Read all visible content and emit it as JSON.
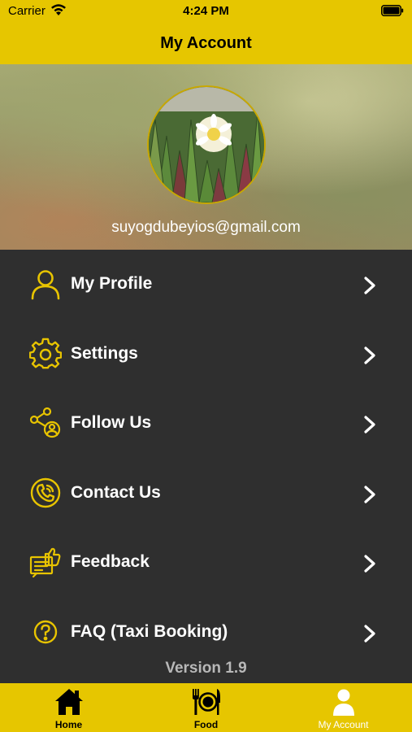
{
  "status_bar": {
    "carrier": "Carrier",
    "time": "4:24 PM"
  },
  "nav": {
    "title": "My Account"
  },
  "profile": {
    "email": "suyogdubeyios@gmail.com"
  },
  "menu": {
    "items": [
      {
        "label": "My Profile",
        "icon": "person-icon"
      },
      {
        "label": "Settings",
        "icon": "gear-icon"
      },
      {
        "label": "Follow Us",
        "icon": "share-user-icon"
      },
      {
        "label": "Contact Us",
        "icon": "phone-icon"
      },
      {
        "label": "Feedback",
        "icon": "feedback-thumbs-up-icon"
      },
      {
        "label": "FAQ (Taxi Booking)",
        "icon": "question-icon"
      }
    ]
  },
  "version": "Version 1.9",
  "tabs": [
    {
      "label": "Home",
      "icon": "home-icon",
      "active": false
    },
    {
      "label": "Food",
      "icon": "food-plate-icon",
      "active": false
    },
    {
      "label": "My Account",
      "icon": "user-icon",
      "active": true
    }
  ],
  "colors": {
    "accent": "#e6c600",
    "icon_yellow": "#e8c400",
    "menu_background": "#2f2f2f",
    "menu_text": "#ffffff",
    "version_text": "#b8b8b8"
  }
}
